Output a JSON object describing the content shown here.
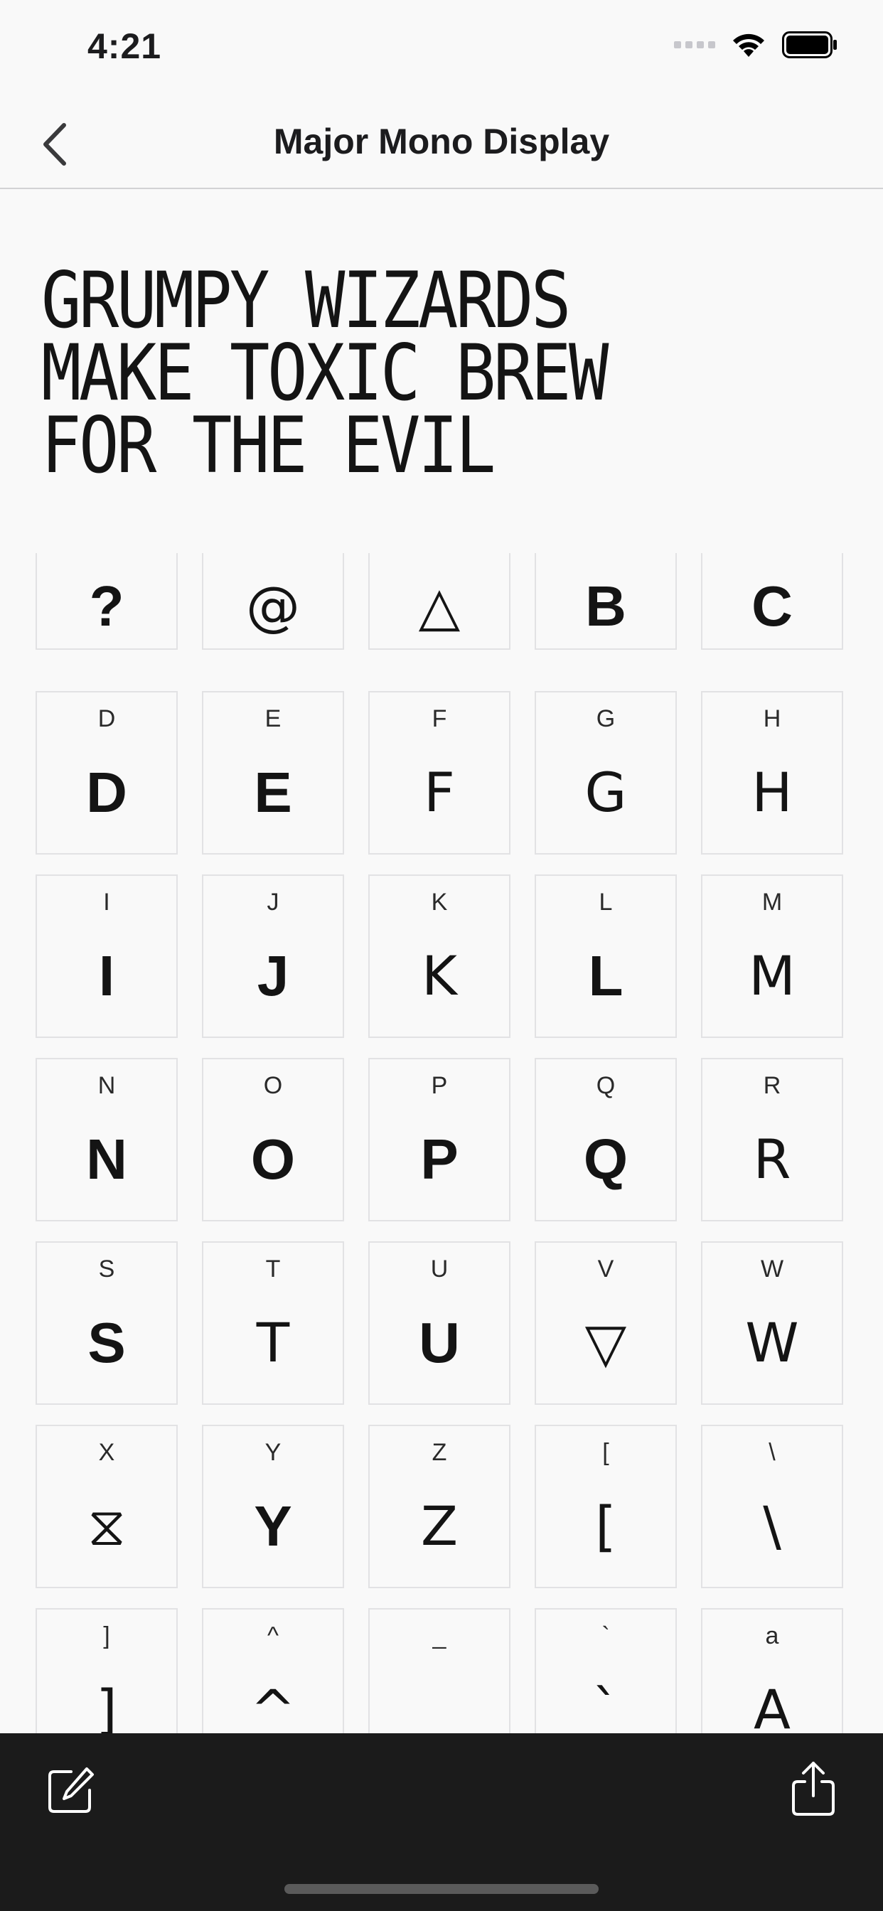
{
  "status_bar": {
    "time": "4:21"
  },
  "nav": {
    "title": "Major Mono Display"
  },
  "pangram": "GRUMPY WIZARDS\nMAKE TOXIC BREW\nFOR THE EVIL",
  "glyphs": [
    {
      "label": "",
      "glyph": "?",
      "style": "heavy"
    },
    {
      "label": "",
      "glyph": "@",
      "style": "thin"
    },
    {
      "label": "",
      "glyph": "△",
      "style": "thin"
    },
    {
      "label": "",
      "glyph": "B",
      "style": "heavy"
    },
    {
      "label": "",
      "glyph": "C",
      "style": "heavy"
    },
    {
      "label": "D",
      "glyph": "D",
      "style": "heavy"
    },
    {
      "label": "E",
      "glyph": "E",
      "style": "heavy"
    },
    {
      "label": "F",
      "glyph": "F",
      "style": "thin"
    },
    {
      "label": "G",
      "glyph": "G",
      "style": "thin"
    },
    {
      "label": "H",
      "glyph": "H",
      "style": "thin"
    },
    {
      "label": "I",
      "glyph": "I",
      "style": "heavy"
    },
    {
      "label": "J",
      "glyph": "J",
      "style": "heavy"
    },
    {
      "label": "K",
      "glyph": "K",
      "style": "thin"
    },
    {
      "label": "L",
      "glyph": "L",
      "style": "heavy"
    },
    {
      "label": "M",
      "glyph": "M",
      "style": "thin"
    },
    {
      "label": "N",
      "glyph": "N",
      "style": "heavy"
    },
    {
      "label": "O",
      "glyph": "O",
      "style": "heavy"
    },
    {
      "label": "P",
      "glyph": "P",
      "style": "heavy"
    },
    {
      "label": "Q",
      "glyph": "Q",
      "style": "heavy"
    },
    {
      "label": "R",
      "glyph": "R",
      "style": "thin"
    },
    {
      "label": "S",
      "glyph": "S",
      "style": "heavy"
    },
    {
      "label": "T",
      "glyph": "T",
      "style": "thin"
    },
    {
      "label": "U",
      "glyph": "U",
      "style": "heavy"
    },
    {
      "label": "V",
      "glyph": "▽",
      "style": "thin"
    },
    {
      "label": "W",
      "glyph": "W",
      "style": "thin"
    },
    {
      "label": "X",
      "glyph": "⧖",
      "style": "thin"
    },
    {
      "label": "Y",
      "glyph": "Y",
      "style": "heavy"
    },
    {
      "label": "Z",
      "glyph": "Z",
      "style": "thin"
    },
    {
      "label": "[",
      "glyph": "[",
      "style": "thin"
    },
    {
      "label": "\\",
      "glyph": "\\",
      "style": "thin"
    },
    {
      "label": "]",
      "glyph": "]",
      "style": "thin"
    },
    {
      "label": "^",
      "glyph": "^",
      "style": "thin"
    },
    {
      "label": "_",
      "glyph": "",
      "style": "thin"
    },
    {
      "label": "`",
      "glyph": "`",
      "style": "thin"
    },
    {
      "label": "a",
      "glyph": "A",
      "style": "thin"
    }
  ],
  "icons": {
    "back": "chevron-left-icon",
    "edit": "compose-icon",
    "share": "share-icon",
    "wifi": "wifi-icon",
    "battery": "battery-icon",
    "signal": "signal-icon"
  },
  "colors": {
    "toolbar": "#1b1b1b",
    "background": "#f9f9f9"
  }
}
